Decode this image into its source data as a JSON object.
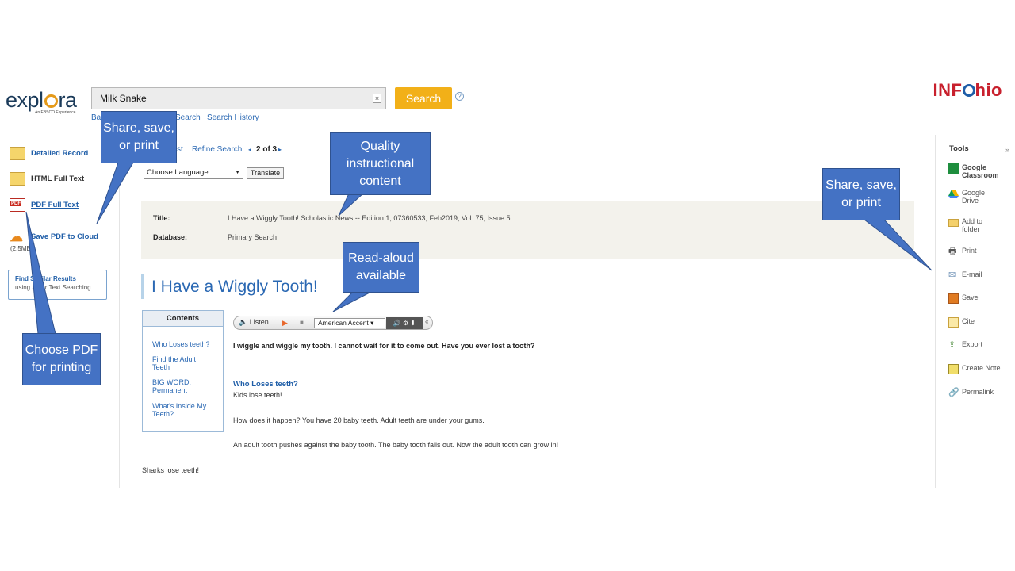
{
  "header": {
    "logo_main": "explora",
    "logo_sub": "An EBSCO Experience",
    "search_value": "Milk Snake",
    "search_button": "Search",
    "help_icon": "?",
    "subnav": {
      "basic_partial": "Ba",
      "search_partial": "Search",
      "history": "Search History"
    },
    "brand": {
      "prefix": "INF",
      "suffix": "hio"
    }
  },
  "left_column": {
    "items": [
      {
        "label": "Detailed Record",
        "icon": "detailed-record-icon"
      },
      {
        "label": "HTML Full Text",
        "icon": "html-icon"
      },
      {
        "label": "PDF Full Text",
        "icon": "pdf-icon"
      },
      {
        "label": "Save PDF to Cloud",
        "icon": "cloud-upload-icon"
      }
    ],
    "file_size": "(2.5MB)",
    "find_similar": {
      "title": "Find Similar Results",
      "subtitle": "using SmartText Searching."
    }
  },
  "center": {
    "result_list_partial": "st",
    "refine_search": "Refine Search",
    "pager_prev": "◂",
    "pager_text": "2 of 3",
    "pager_next": "▸",
    "language_select": "Choose Language",
    "translate_button": "Translate",
    "meta": {
      "title_label": "Title:",
      "title_value": "I Have a Wiggly Tooth! Scholastic News -- Edition 1, 07360533, Feb2019, Vol. 75, Issue 5",
      "database_label": "Database:",
      "database_value": "Primary Search"
    },
    "article_title": "I Have a Wiggly Tooth!",
    "contents": {
      "heading": "Contents",
      "links": [
        "Who Loses teeth?",
        "Find the Adult Teeth",
        "BIG WORD: Permanent",
        "What's Inside My Teeth?"
      ]
    },
    "player": {
      "listen": "Listen",
      "accent": "American Accent",
      "collapse": "«"
    },
    "body": {
      "intro": "I wiggle and wiggle my tooth. I cannot wait for it to come out. Have you ever lost a tooth?",
      "subhead": "Who Loses teeth?",
      "p1": "Kids lose teeth!",
      "p2": "How does it happen? You have 20 baby teeth. Adult teeth are under your gums.",
      "p3": "An adult tooth pushes against the baby tooth. The baby tooth falls out. Now the adult tooth can grow in!",
      "p4": "Sharks lose teeth!"
    }
  },
  "tools": {
    "title": "Tools",
    "toggle": "»",
    "items": [
      {
        "label": "Google Classroom",
        "icon": "google-classroom-icon"
      },
      {
        "label": "Google Drive",
        "icon": "google-drive-icon"
      },
      {
        "label": "Add to folder",
        "icon": "folder-icon"
      },
      {
        "label": "Print",
        "icon": "print-icon"
      },
      {
        "label": "E-mail",
        "icon": "email-icon"
      },
      {
        "label": "Save",
        "icon": "save-icon"
      },
      {
        "label": "Cite",
        "icon": "cite-icon"
      },
      {
        "label": "Export",
        "icon": "export-icon"
      },
      {
        "label": "Create Note",
        "icon": "note-icon"
      },
      {
        "label": "Permalink",
        "icon": "link-icon"
      }
    ]
  },
  "callouts": {
    "share_left": "Share, save, or print",
    "quality": "Quality instructional content",
    "share_right": "Share, save, or print",
    "read_aloud": "Read-aloud available",
    "choose_pdf": "Choose PDF for printing"
  },
  "colors": {
    "accent_blue": "#2a68b3",
    "search_button": "#f2b018",
    "brand_red": "#c8202d",
    "callout_blue": "#4472c4"
  }
}
